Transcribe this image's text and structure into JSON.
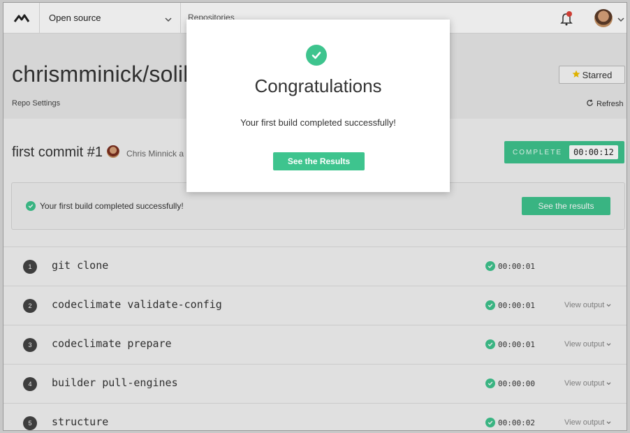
{
  "nav": {
    "org": "Open source",
    "repositories": "Repositories"
  },
  "repo": {
    "title": "chrismminick/solilo",
    "settings": "Repo Settings",
    "starred": "Starred",
    "refresh": "Refresh"
  },
  "build": {
    "commit_title": "first commit #1",
    "author": "Chris Minnick a",
    "status": "COMPLETE",
    "timer": "00:00:12",
    "success_message": "Your first build completed successfully!",
    "see_results": "See the results"
  },
  "steps": [
    {
      "num": "1",
      "name": "git clone",
      "duration": "00:00:01",
      "view": ""
    },
    {
      "num": "2",
      "name": "codeclimate validate-config",
      "duration": "00:00:01",
      "view": "View output"
    },
    {
      "num": "3",
      "name": "codeclimate prepare",
      "duration": "00:00:01",
      "view": "View output"
    },
    {
      "num": "4",
      "name": "builder pull-engines",
      "duration": "00:00:00",
      "view": "View output"
    },
    {
      "num": "5",
      "name": "structure",
      "duration": "00:00:02",
      "view": "View output"
    }
  ],
  "modal": {
    "heading": "Congratulations",
    "message": "Your first build completed successfully!",
    "button": "See the Results"
  },
  "colors": {
    "accent": "#3ec48e",
    "notification": "#e0443a",
    "star": "#f2c200"
  }
}
